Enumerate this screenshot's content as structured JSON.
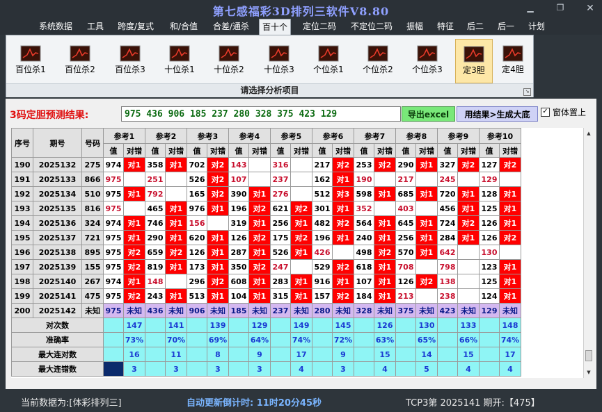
{
  "window": {
    "title": "第七感福彩3D排列三软件V8.80"
  },
  "menu": [
    "系统数据",
    "工具",
    "跨度/复式",
    "和/合值",
    "合差/通杀",
    "百十个",
    "定位二码",
    "不定位二码",
    "振幅",
    "特征",
    "后二",
    "后一",
    "计划"
  ],
  "menu_active": "百十个",
  "ribbon": {
    "buttons": [
      "百位杀1",
      "百位杀2",
      "百位杀3",
      "十位杀1",
      "十位杀2",
      "十位杀3",
      "个位杀1",
      "个位杀2",
      "个位杀3",
      "定3胆",
      "定4胆"
    ],
    "active": "定3胆",
    "footer": "请选择分析项目"
  },
  "prediction": {
    "label": "3码定胆预测结果:",
    "value": "975 436 906 185 237 280 328 375 423 129",
    "excel_button": "导出excel",
    "gen_button": "用结果>生成大底",
    "topmost_label": "窗体置上",
    "topmost_checked": true
  },
  "table": {
    "headers": {
      "seq": "序号",
      "period": "期号",
      "number": "号码",
      "value": "值",
      "result": "对错"
    },
    "ref_labels": [
      "参考1",
      "参考2",
      "参考3",
      "参考4",
      "参考5",
      "参考6",
      "参考7",
      "参考8",
      "参考9",
      "参考10"
    ],
    "rows": [
      {
        "seq": "190",
        "period": "2025132",
        "num": "275",
        "cells": [
          [
            "974",
            "对1"
          ],
          [
            "358",
            "对1"
          ],
          [
            "702",
            "对2"
          ],
          [
            "143",
            ""
          ],
          [
            "316",
            ""
          ],
          [
            "217",
            "对2"
          ],
          [
            "253",
            "对2"
          ],
          [
            "290",
            "对1"
          ],
          [
            "327",
            "对2"
          ],
          [
            "127",
            "对2"
          ]
        ]
      },
      {
        "seq": "191",
        "period": "2025133",
        "num": "866",
        "cells": [
          [
            "975",
            ""
          ],
          [
            "251",
            ""
          ],
          [
            "526",
            "对2"
          ],
          [
            "107",
            ""
          ],
          [
            "237",
            ""
          ],
          [
            "162",
            "对1"
          ],
          [
            "190",
            ""
          ],
          [
            "217",
            ""
          ],
          [
            "245",
            ""
          ],
          [
            "129",
            ""
          ]
        ]
      },
      {
        "seq": "192",
        "period": "2025134",
        "num": "510",
        "cells": [
          [
            "975",
            "对1"
          ],
          [
            "792",
            ""
          ],
          [
            "165",
            "对2"
          ],
          [
            "390",
            "对1"
          ],
          [
            "276",
            ""
          ],
          [
            "512",
            "对3"
          ],
          [
            "598",
            "对1"
          ],
          [
            "685",
            "对1"
          ],
          [
            "720",
            "对1"
          ],
          [
            "128",
            "对1"
          ]
        ]
      },
      {
        "seq": "193",
        "period": "2025135",
        "num": "816",
        "cells": [
          [
            "975",
            ""
          ],
          [
            "465",
            "对1"
          ],
          [
            "976",
            "对1"
          ],
          [
            "196",
            "对2"
          ],
          [
            "621",
            "对2"
          ],
          [
            "301",
            "对1"
          ],
          [
            "352",
            ""
          ],
          [
            "403",
            ""
          ],
          [
            "456",
            "对1"
          ],
          [
            "125",
            "对1"
          ]
        ]
      },
      {
        "seq": "194",
        "period": "2025136",
        "num": "324",
        "cells": [
          [
            "974",
            "对1"
          ],
          [
            "746",
            "对1"
          ],
          [
            "156",
            ""
          ],
          [
            "319",
            "对1"
          ],
          [
            "256",
            "对1"
          ],
          [
            "482",
            "对2"
          ],
          [
            "564",
            "对1"
          ],
          [
            "645",
            "对1"
          ],
          [
            "724",
            "对2"
          ],
          [
            "126",
            "对1"
          ]
        ]
      },
      {
        "seq": "195",
        "period": "2025137",
        "num": "721",
        "cells": [
          [
            "975",
            "对1"
          ],
          [
            "290",
            "对1"
          ],
          [
            "620",
            "对1"
          ],
          [
            "126",
            "对2"
          ],
          [
            "175",
            "对2"
          ],
          [
            "196",
            "对1"
          ],
          [
            "240",
            "对1"
          ],
          [
            "256",
            "对1"
          ],
          [
            "284",
            "对1"
          ],
          [
            "126",
            "对2"
          ]
        ]
      },
      {
        "seq": "196",
        "period": "2025138",
        "num": "895",
        "cells": [
          [
            "975",
            "对2"
          ],
          [
            "659",
            "对2"
          ],
          [
            "126",
            "对1"
          ],
          [
            "287",
            "对1"
          ],
          [
            "526",
            "对1"
          ],
          [
            "426",
            ""
          ],
          [
            "498",
            "对2"
          ],
          [
            "570",
            "对1"
          ],
          [
            "642",
            ""
          ],
          [
            "130",
            ""
          ]
        ]
      },
      {
        "seq": "197",
        "period": "2025139",
        "num": "155",
        "cells": [
          [
            "975",
            "对2"
          ],
          [
            "819",
            "对1"
          ],
          [
            "173",
            "对1"
          ],
          [
            "350",
            "对2"
          ],
          [
            "247",
            ""
          ],
          [
            "529",
            "对2"
          ],
          [
            "618",
            "对1"
          ],
          [
            "708",
            ""
          ],
          [
            "798",
            ""
          ],
          [
            "123",
            "对1"
          ]
        ]
      },
      {
        "seq": "198",
        "period": "2025140",
        "num": "267",
        "cells": [
          [
            "974",
            "对1"
          ],
          [
            "148",
            ""
          ],
          [
            "296",
            "对2"
          ],
          [
            "608",
            "对1"
          ],
          [
            "283",
            "对1"
          ],
          [
            "916",
            "对1"
          ],
          [
            "107",
            "对1"
          ],
          [
            "126",
            "对2"
          ],
          [
            "138",
            ""
          ],
          [
            "125",
            "对1"
          ]
        ]
      },
      {
        "seq": "199",
        "period": "2025141",
        "num": "475",
        "cells": [
          [
            "975",
            "对2"
          ],
          [
            "243",
            "对1"
          ],
          [
            "513",
            "对1"
          ],
          [
            "104",
            "对1"
          ],
          [
            "315",
            "对1"
          ],
          [
            "157",
            "对2"
          ],
          [
            "184",
            "对1"
          ],
          [
            "213",
            ""
          ],
          [
            "238",
            ""
          ],
          [
            "124",
            "对1"
          ]
        ]
      },
      {
        "seq": "200",
        "period": "2025142",
        "num": "未知",
        "cells": [
          [
            "975",
            "未知"
          ],
          [
            "436",
            "未知"
          ],
          [
            "906",
            "未知"
          ],
          [
            "185",
            "未知"
          ],
          [
            "237",
            "未知"
          ],
          [
            "280",
            "未知"
          ],
          [
            "328",
            "未知"
          ],
          [
            "375",
            "未知"
          ],
          [
            "423",
            "未知"
          ],
          [
            "129",
            "未知"
          ]
        ]
      }
    ],
    "summary": [
      {
        "label": "对次数",
        "values": [
          "147",
          "141",
          "139",
          "129",
          "149",
          "145",
          "126",
          "130",
          "133",
          "148"
        ]
      },
      {
        "label": "准确率",
        "values": [
          "73%",
          "70%",
          "69%",
          "64%",
          "74%",
          "72%",
          "63%",
          "65%",
          "66%",
          "74%"
        ]
      },
      {
        "label": "最大连对数",
        "values": [
          "16",
          "11",
          "8",
          "9",
          "17",
          "9",
          "15",
          "14",
          "15",
          "17"
        ]
      },
      {
        "label": "最大连错数",
        "values": [
          "3",
          "3",
          "3",
          "3",
          "4",
          "3",
          "4",
          "5",
          "4",
          "4"
        ]
      }
    ]
  },
  "status": {
    "current_data": "当前数据为:[体彩排列三]",
    "countdown": "自动更新倒计时: 11时20分45秒",
    "draw_info": "TCP3第 2025141 期开:【475】"
  },
  "colors": {
    "hit": "#ff0000",
    "unknown": "#d4b8f0",
    "summary": "#8ff5f5",
    "prediction_text": "#0a6a10",
    "title": "#8fa0ff"
  }
}
